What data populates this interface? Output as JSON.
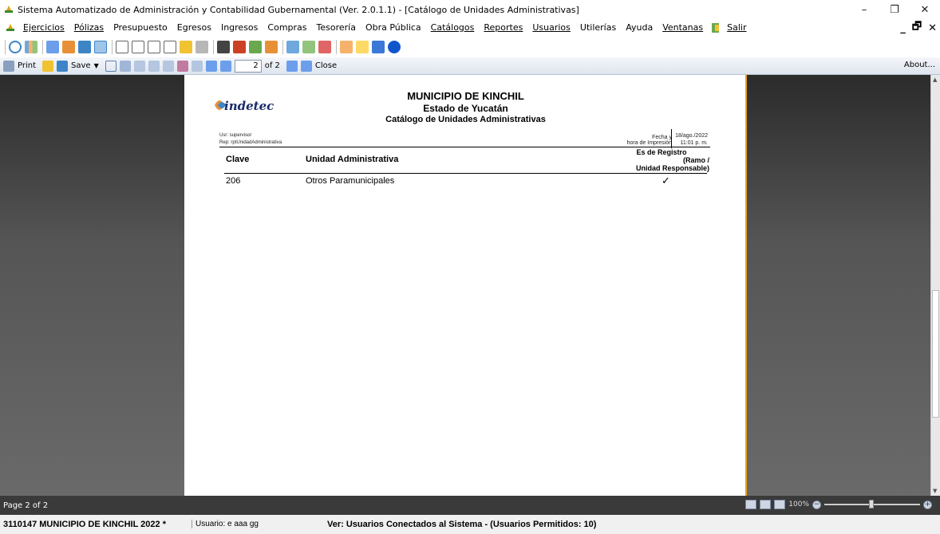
{
  "window": {
    "title": "Sistema Automatizado de Administración y Contabilidad Gubernamental  (Ver. 2.0.1.1) - [Catálogo de Unidades Administrativas]",
    "minimize": "–",
    "restore": "❐",
    "close": "✕"
  },
  "menu": {
    "items": [
      "Ejercicios",
      "Pólizas",
      "Presupuesto",
      "Egresos",
      "Ingresos",
      "Compras",
      "Tesorería",
      "Obra Pública",
      "Catálogos",
      "Reportes",
      "Usuarios",
      "Utilerías",
      "Ayuda",
      "Ventanas",
      "Salir"
    ],
    "mdi_min": "_",
    "mdi_restore": "🗗",
    "mdi_close": "✕"
  },
  "viewer_toolbar": {
    "print": "Print",
    "save": "Save",
    "page_value": "2",
    "page_of": "of 2",
    "close": "Close",
    "about": "About..."
  },
  "report": {
    "logo": "indetec",
    "title": "MUNICIPIO DE KINCHIL",
    "subtitle": "Estado de Yucatán",
    "catalog": "Catálogo de Unidades Administrativas",
    "user": "Usr: supervisor",
    "rep": "Rep: rptUnidadAdministrativa",
    "fecha_label": "Fecha y",
    "fecha_value": "18/ago./2022",
    "hora_label": "hora de Impresión",
    "hora_value": "11:01 p. m.",
    "col_clave": "Clave",
    "col_unidad": "Unidad Administrativa",
    "col_registro_1": "Es de Registro",
    "col_registro_2": "(Ramo /",
    "col_registro_3": "Unidad Responsable)",
    "rows": [
      {
        "clave": "206",
        "unidad": "Otros Paramunicipales",
        "registro": "✓"
      }
    ]
  },
  "page_status": {
    "page": "Page 2 of 2",
    "zoom": "100%"
  },
  "app_status": {
    "entity": "3110147 MUNICIPIO DE KINCHIL  2022  *",
    "user": "Usuario: e aaa gg",
    "connected": "Ver: Usuarios Conectados al Sistema - (Usuarios Permitidos: 10)"
  },
  "colors": {
    "accent_orange": "#e7a21e",
    "logo_blue": "#1a2a6a"
  }
}
